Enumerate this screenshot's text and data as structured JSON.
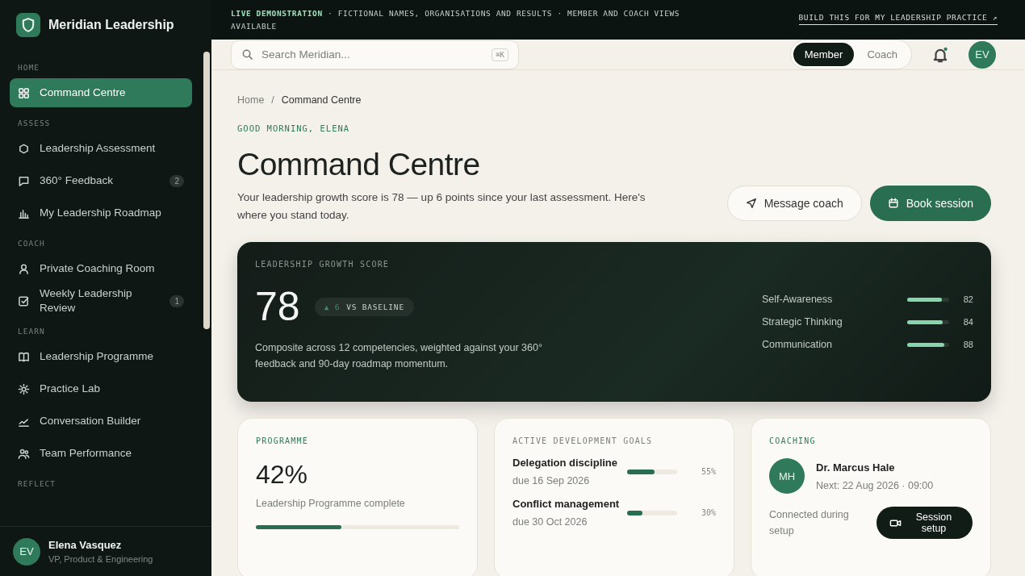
{
  "brand": {
    "name": "Meridian Leadership"
  },
  "sidebar": {
    "sections": [
      {
        "label": "HOME",
        "items": [
          {
            "label": "Command Centre",
            "selected": true
          }
        ]
      },
      {
        "label": "ASSESS",
        "items": [
          {
            "label": "Leadership Assessment",
            "selected": false
          },
          {
            "label": "360° Feedback",
            "selected": false,
            "badge": "2"
          },
          {
            "label": "My Leadership Roadmap",
            "selected": false
          }
        ]
      },
      {
        "label": "COACH",
        "items": [
          {
            "label": "Private Coaching Room",
            "selected": false
          },
          {
            "label": "Weekly Leadership Review",
            "selected": false,
            "badge": "1"
          }
        ]
      },
      {
        "label": "LEARN",
        "items": [
          {
            "label": "Leadership Programme",
            "selected": false
          },
          {
            "label": "Practice Lab",
            "selected": false
          },
          {
            "label": "Conversation Builder",
            "selected": false
          },
          {
            "label": "Team Performance",
            "selected": false
          }
        ]
      },
      {
        "label": "REFLECT"
      }
    ],
    "user": {
      "initials": "EV",
      "name": "Elena Vasquez",
      "role": "VP, Product & Engineering"
    }
  },
  "banner": {
    "lead": "LIVE DEMONSTRATION",
    "text": " · FICTIONAL NAMES, ORGANISATIONS AND RESULTS · MEMBER AND COACH VIEWS AVAILABLE",
    "link": "BUILD THIS FOR MY LEADERSHIP PRACTICE ↗"
  },
  "header": {
    "search": {
      "placeholder": "Search Meridian...",
      "shortcut": "⌘K"
    },
    "view_toggle": [
      {
        "label": "Member",
        "selected": true
      },
      {
        "label": "Coach",
        "selected": false
      }
    ],
    "notifications": {
      "unread": true
    },
    "avatar": "EV"
  },
  "breadcrumb": [
    {
      "label": "Home"
    },
    {
      "label": "Command Centre"
    }
  ],
  "breadcrumb_separator": "/",
  "greeting": "GOOD MORNING, ELENA",
  "title": "Command Centre",
  "subtitle": "Your leadership growth score is 78 — up 6 points since your last assessment. Here's where you stand today.",
  "actions": [
    {
      "label": "Message coach",
      "kind": "secondary"
    },
    {
      "label": "Book session",
      "kind": "primary"
    }
  ],
  "score_card": {
    "label": "LEADERSHIP GROWTH SCORE",
    "score": "78",
    "delta": "▲ 6",
    "delta_label": "VS BASELINE",
    "description": "Composite across 12 competencies, weighted against your 360° feedback and 90-day roadmap momentum.",
    "competencies": [
      {
        "name": "Self-Awareness",
        "level": 0.82,
        "value": "82"
      },
      {
        "name": "Strategic Thinking",
        "level": 0.84,
        "value": "84"
      },
      {
        "name": "Communication",
        "level": 0.88,
        "value": "88"
      }
    ]
  },
  "cards": [
    {
      "kind": "programme",
      "label": "PROGRAMME",
      "value": "42%",
      "caption": "Leadership Programme complete",
      "level": 0.42
    },
    {
      "kind": "goals",
      "label": "ACTIVE DEVELOPMENT GOALS",
      "goals": [
        {
          "name": "Delegation discipline",
          "due": "due 16 Sep 2026",
          "level": 0.55,
          "value": "55%"
        },
        {
          "name": "Conflict management",
          "due": "due 30 Oct 2026",
          "level": 0.3,
          "value": "30%"
        }
      ]
    },
    {
      "kind": "coaching",
      "label": "COACHING",
      "coach": {
        "initials": "MH",
        "name": "Dr. Marcus Hale",
        "next": "Next: 22 Aug 2026 · 09:00"
      },
      "status": "Connected during setup",
      "button": "Session setup"
    }
  ]
}
